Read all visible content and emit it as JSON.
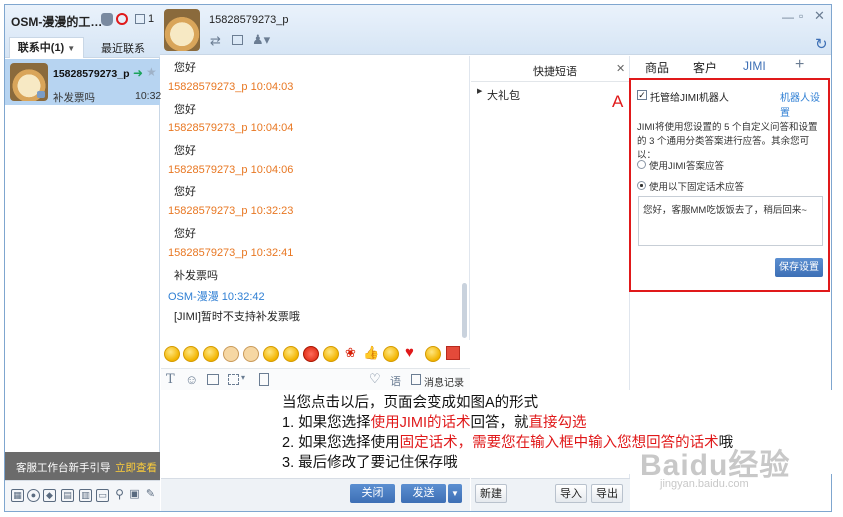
{
  "left": {
    "app_title": "OSM-漫漫的工…",
    "badge_count": "1",
    "tab_contacts": "联系中(1)",
    "tab_recent": "最近联系",
    "contact": {
      "name": "15828579273_p",
      "last_msg": "补发票吗",
      "time": "10:32"
    },
    "guide_text": "客服工作台新手引导",
    "guide_link": "立即查看"
  },
  "header": {
    "contact_name": "15828579273_p"
  },
  "messages": [
    {
      "sender": "",
      "time": "",
      "text": "您好",
      "color": "#222222"
    },
    {
      "sender": "15828579273_p",
      "time": "10:04:03",
      "text": "您好",
      "color": "#e87722"
    },
    {
      "sender": "15828579273_p",
      "time": "10:04:04",
      "text": "您好",
      "color": "#e87722"
    },
    {
      "sender": "15828579273_p",
      "time": "10:04:06",
      "text": "您好",
      "color": "#e87722"
    },
    {
      "sender": "15828579273_p",
      "time": "10:32:23",
      "text": "您好",
      "color": "#e87722"
    },
    {
      "sender": "15828579273_p",
      "time": "10:32:41",
      "text": "补发票吗",
      "color": "#e87722"
    },
    {
      "sender": "OSM-漫漫",
      "time": "10:32:42",
      "text": "[JIMI]暂时不支持补发票哦",
      "color": "#2f7fd4"
    }
  ],
  "input_tools": {
    "history_label": "语",
    "msg_record": "消息记录"
  },
  "buttons": {
    "close": "关闭",
    "send": "发送",
    "new": "新建",
    "import": "导入",
    "export": "导出"
  },
  "quick_phrases": {
    "title": "快捷短语",
    "group": "大礼包"
  },
  "right": {
    "tabs": [
      "商品",
      "客户",
      "JIMI"
    ],
    "add_tab": "+",
    "trust_checkbox": "托管给JIMI机器人",
    "robot_settings": "机器人设置",
    "description": "JIMI将使用您设置的 5 个自定义问答和设置的 3 个通用分类答案进行应答。其余您可以：",
    "option_jimi": "使用JIMI答案应答",
    "option_fixed": "使用以下固定话术应答",
    "fixed_reply": "您好，客服MM吃饭饭去了，稍后回来~",
    "save_button": "保存设置",
    "marker_label": "A"
  },
  "annotation": {
    "line0": "当您点击以后，页面会变成如图A的形式",
    "line1_a": "1.   如果您选择",
    "line1_b": "使用JIMI的话术",
    "line1_c": "回答，就",
    "line1_d": "直接勾选",
    "line2_a": "2.   如果您选择使用",
    "line2_b": "固定话术，需要您在输入框中输入您想回答的话术",
    "line2_c": "哦",
    "line3": "3.   最后修改了要记住保存哦"
  },
  "watermark": {
    "text": "Baidu经验",
    "sub": "jingyan.baidu.com"
  }
}
